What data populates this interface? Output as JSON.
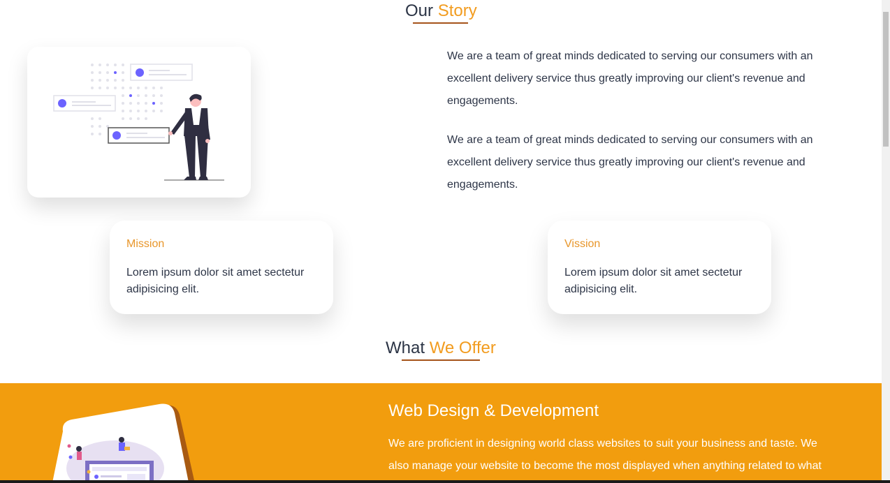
{
  "story": {
    "title_main": "Our",
    "title_accent": "Story",
    "paragraphs": [
      "We are a team of great minds dedicated to serving our consumers with an excellent delivery service thus greatly improving our client's revenue and engagements.",
      "We are a team of great minds dedicated to serving our consumers with an excellent delivery service thus greatly improving our client's revenue and engagements."
    ]
  },
  "mission": {
    "title": "Mission",
    "body": "Lorem ipsum dolor sit amet sectetur adipisicing elit."
  },
  "vision": {
    "title": "Vission",
    "body": "Lorem ipsum dolor sit amet sectetur adipisicing elit."
  },
  "offer": {
    "title_main": "What",
    "title_accent": "We Offer",
    "service_heading": "Web Design & Development",
    "service_text": "We are proficient in designing world class websites to suit your business and taste. We also manage your website to become the most displayed when anything related to what"
  },
  "colors": {
    "accent": "#f29c1f",
    "band": "#f29d0e",
    "underline": "#a5531a",
    "illustration_purple": "#6c63ff"
  },
  "icons": {
    "story_illustration": "presenter-with-dashboard-illustration",
    "offer_illustration": "web-design-laptop-illustration"
  }
}
